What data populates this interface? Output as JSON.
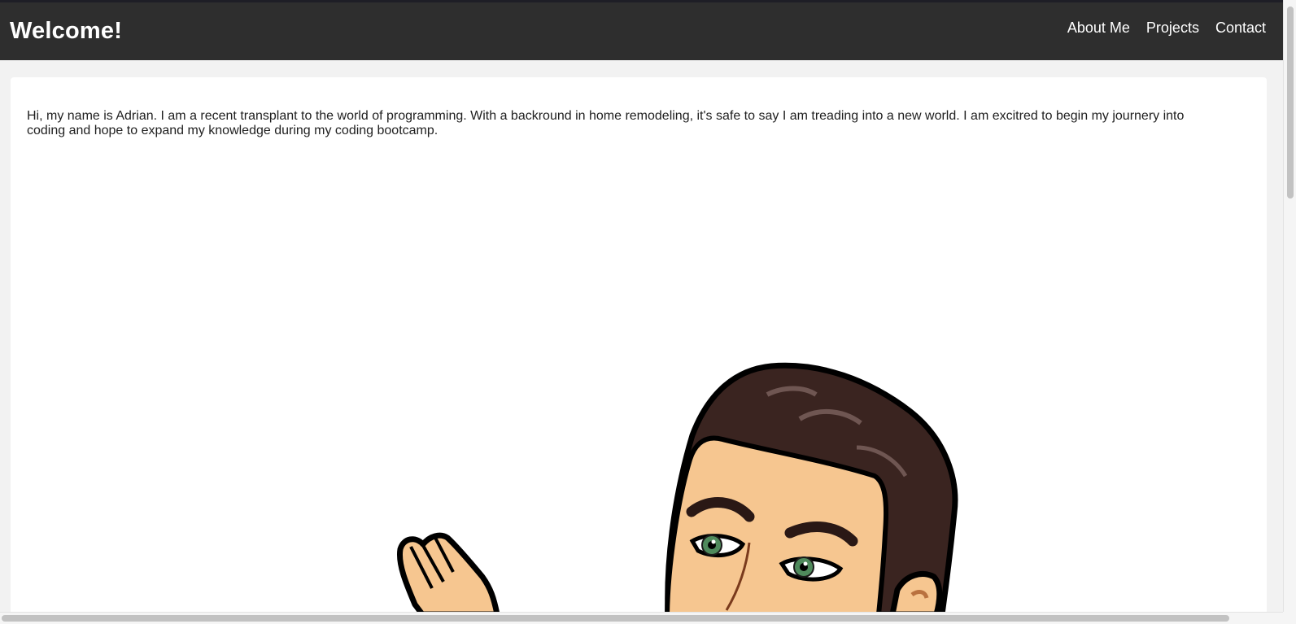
{
  "header": {
    "title": "Welcome!",
    "nav": [
      "About Me",
      "Projects",
      "Contact"
    ]
  },
  "main": {
    "intro": "Hi, my name is Adrian. I am a recent transplant to the world of programming. With a backround in home remodeling, it's safe to say I am treading into a new world. I am excitred to begin my journery into coding and hope to expand my knowledge during my coding bootcamp."
  },
  "colors": {
    "header_bg": "#2e2e2e",
    "page_bg": "#f2f2f2",
    "card_bg": "#ffffff",
    "skin": "#f6c690",
    "hair": "#3a2420",
    "eyes": "#4f8a5c"
  }
}
